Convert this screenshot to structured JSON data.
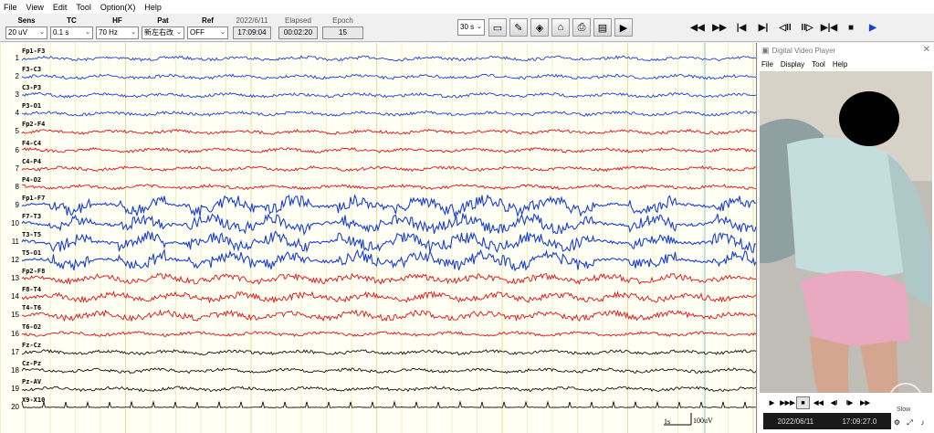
{
  "menu": [
    "File",
    "View",
    "Edit",
    "Tool",
    "Option(X)",
    "Help"
  ],
  "toolbar": {
    "sens": {
      "label": "Sens",
      "value": "20 uV"
    },
    "tc": {
      "label": "TC",
      "value": "0.1 s"
    },
    "hf": {
      "label": "HF",
      "value": "70 Hz"
    },
    "pat": {
      "label": "Pat",
      "value": "新左右改"
    },
    "ref": {
      "label": "Ref",
      "value": "OFF"
    },
    "date": {
      "label": "2022/6/11",
      "value": "17:09:04"
    },
    "elapsed": {
      "label": "Elapsed",
      "value": "00:02:20"
    },
    "epoch": {
      "label": "Epoch",
      "value": "15"
    },
    "page_select": "30 s",
    "tool_icons": [
      "save-icon",
      "montage-icon",
      "filter-icon",
      "marker-icon",
      "print-icon",
      "export-icon",
      "video-icon"
    ],
    "playback_icons": [
      "rewind-fast-icon",
      "forward-fast-icon",
      "skip-start-icon",
      "skip-end-icon",
      "step-back-icon",
      "step-forward-icon",
      "compress-icon",
      "stop-icon",
      "play-icon"
    ],
    "playback_glyphs": [
      "◀◀",
      "▶▶",
      "|◀",
      "▶|",
      "◁II",
      "II▷",
      "▶|◀",
      "■",
      "▶"
    ]
  },
  "channels": [
    {
      "num": "1",
      "label": "Fp1-F3",
      "color": "blue"
    },
    {
      "num": "2",
      "label": "F3-C3",
      "color": "blue"
    },
    {
      "num": "3",
      "label": "C3-P3",
      "color": "blue"
    },
    {
      "num": "4",
      "label": "P3-O1",
      "color": "blue"
    },
    {
      "num": "5",
      "label": "Fp2-F4",
      "color": "red"
    },
    {
      "num": "6",
      "label": "F4-C4",
      "color": "red"
    },
    {
      "num": "7",
      "label": "C4-P4",
      "color": "red"
    },
    {
      "num": "8",
      "label": "P4-O2",
      "color": "red"
    },
    {
      "num": "9",
      "label": "Fp1-F7",
      "color": "blue"
    },
    {
      "num": "10",
      "label": "F7-T3",
      "color": "blue"
    },
    {
      "num": "11",
      "label": "T3-T5",
      "color": "blue"
    },
    {
      "num": "12",
      "label": "T5-O1",
      "color": "blue"
    },
    {
      "num": "13",
      "label": "Fp2-F8",
      "color": "red"
    },
    {
      "num": "14",
      "label": "F8-T4",
      "color": "red"
    },
    {
      "num": "15",
      "label": "T4-T6",
      "color": "red"
    },
    {
      "num": "16",
      "label": "T6-O2",
      "color": "red"
    },
    {
      "num": "17",
      "label": "Fz-Cz",
      "color": "black"
    },
    {
      "num": "18",
      "label": "Cz-Pz",
      "color": "black"
    },
    {
      "num": "19",
      "label": "Pz-AV",
      "color": "black"
    },
    {
      "num": "20",
      "label": "X9-X10",
      "color": "black"
    }
  ],
  "colors": {
    "blue": "#1a3fd4",
    "red": "#e01010",
    "black": "#111111",
    "grid": "#e6dc8a"
  },
  "scale": {
    "time": "1s",
    "amp": "100uV"
  },
  "video_player": {
    "title": "Digital Video Player",
    "menu": [
      "File",
      "Display",
      "Tool",
      "Help"
    ],
    "controls": [
      "▶",
      "▶▶▶",
      "■",
      "◀◀",
      "◀I",
      "I▶",
      "▶▶"
    ],
    "date": "2022/06/11",
    "time": "17:09:27.0",
    "speed": "Slow",
    "small_icons": [
      "settings-icon",
      "fullscreen-icon",
      "volume-icon"
    ]
  }
}
